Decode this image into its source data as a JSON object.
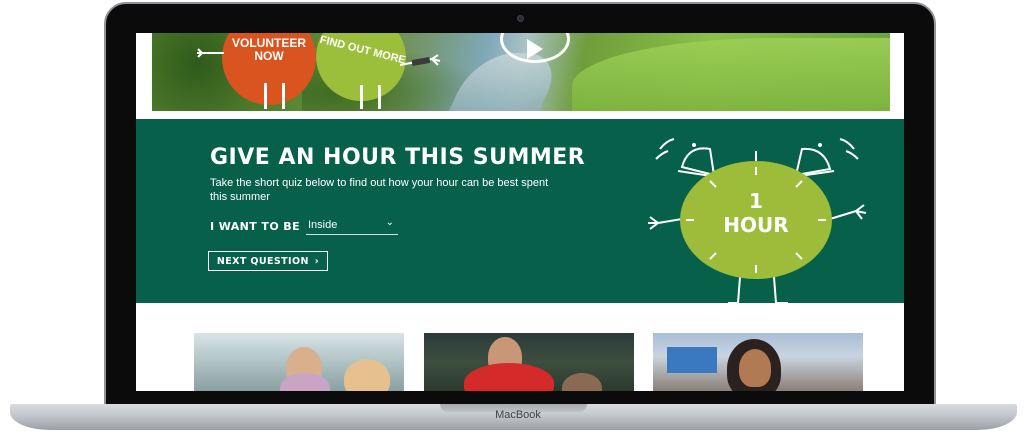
{
  "device": {
    "brand": "MacBook"
  },
  "hero": {
    "badges": [
      {
        "label": "VOLUNTEER NOW",
        "color": "#d9541e"
      },
      {
        "label": "FIND OUT MORE",
        "color": "#9bbf3a"
      }
    ],
    "media": {
      "icon": "play-icon"
    }
  },
  "promo": {
    "background": "#07604a",
    "title": "GIVE AN HOUR THIS SUMMER",
    "subtitle": "Take the short quiz below to find out how your hour can be best spent this summer",
    "question_label": "I WANT TO BE",
    "select": {
      "value": "Inside",
      "icon": "chevron-down-icon"
    },
    "next_button": {
      "label": "NEXT QUESTION",
      "icon": "chevron-right-icon"
    },
    "clock": {
      "line1": "1",
      "line2": "HOUR",
      "color": "#9cbc3a"
    }
  },
  "cards": [
    {
      "icon": "photo-icon"
    },
    {
      "icon": "photo-icon"
    },
    {
      "icon": "photo-icon"
    }
  ]
}
